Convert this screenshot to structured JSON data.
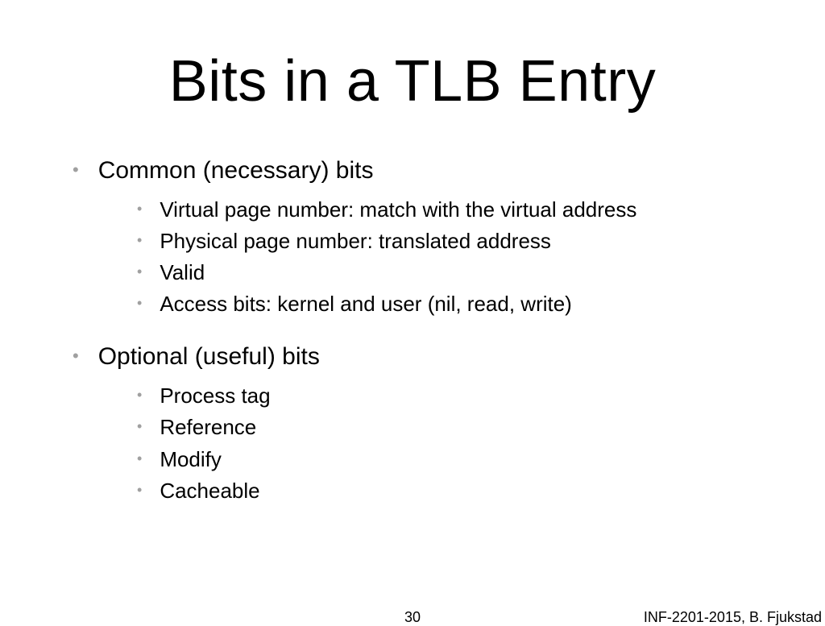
{
  "title": "Bits in a TLB Entry",
  "sections": [
    {
      "heading": "Common (necessary) bits",
      "items": [
        "Virtual page number: match with the virtual address",
        "Physical page number: translated address",
        "Valid",
        "Access bits: kernel and user (nil, read, write)"
      ]
    },
    {
      "heading": "Optional (useful) bits",
      "items": [
        "Process tag",
        "Reference",
        "Modify",
        "Cacheable"
      ]
    }
  ],
  "footer": {
    "page_number": "30",
    "right_text": "INF-2201-2015, B. Fjukstad"
  }
}
